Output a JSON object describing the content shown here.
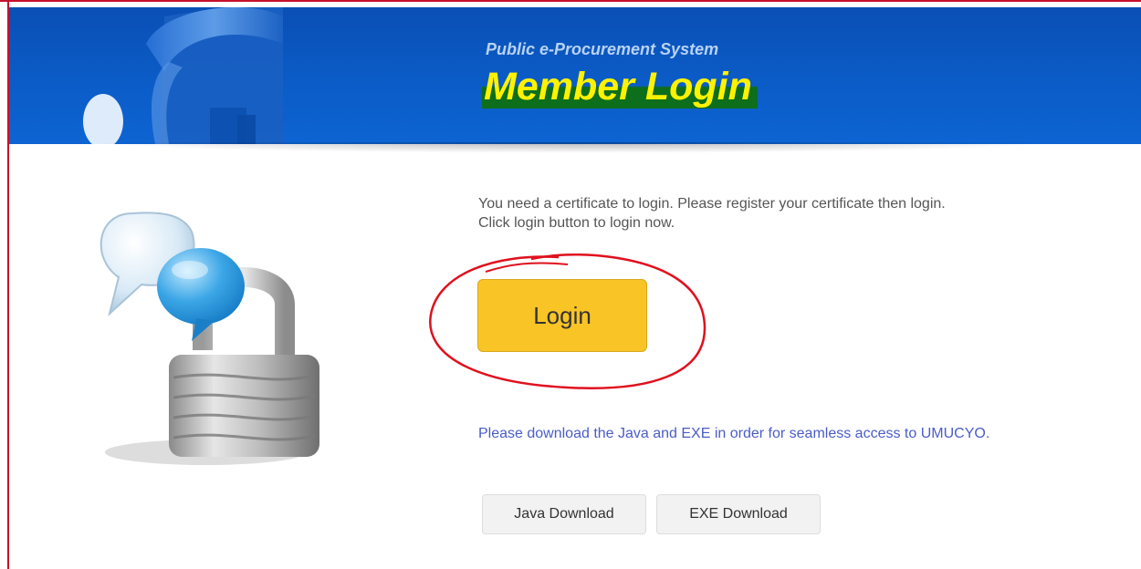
{
  "banner": {
    "subtitle": "Public e-Procurement System",
    "title": "Member Login"
  },
  "main": {
    "intro": "You need a certificate to login. Please register your certificate then login. Click login button to login now.",
    "login_label": "Login",
    "download_note": "Please download the Java and EXE in order for seamless access to UMUCYO.",
    "java_label": "Java Download",
    "exe_label": "EXE Download"
  },
  "colors": {
    "banner_blue": "#0b5cc7",
    "title_yellow": "#fff200",
    "login_yellow": "#f9c425",
    "link_blue": "#4a5cc8",
    "annotation_red": "#e0101e"
  },
  "icons": {
    "illustration": "padlock-with-chat-bubbles-icon",
    "banner_art": "key-icon"
  }
}
